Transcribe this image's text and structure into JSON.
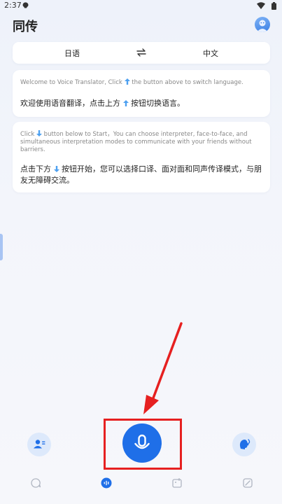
{
  "status_bar": {
    "time": "2:37",
    "app_icon": "qq-icon",
    "icons": [
      "wifi-icon",
      "battery-icon"
    ]
  },
  "header": {
    "title": "同传",
    "avatar_icon": "user-avatar"
  },
  "language_selector": {
    "source": "日语",
    "target": "中文",
    "swap_icon": "swap-arrows-icon"
  },
  "cards": [
    {
      "en_before": "Welcome to Voice Translator, Click",
      "en_after": "the button above to switch language.",
      "zh_before": "欢迎使用语音翻译，点击上方",
      "zh_after": "按钮切换语言。",
      "icon": "arrow-up-icon"
    },
    {
      "en_before": "Click",
      "en_after": "button below to Start，You can choose interpreter, face-to-face, and simultaneous interpretation modes to communicate with your friends without barriers.",
      "zh_before": "点击下方",
      "zh_after": "按钮开始，您可以选择口译、面对面和同声传译模式，与朋友无障碍交流。",
      "icon": "arrow-down-icon"
    }
  ],
  "bottom_controls": {
    "left_icon": "contacts-icon",
    "center_icon": "microphone-icon",
    "right_icon": "face-to-face-icon"
  },
  "nav": {
    "items": [
      "chat-icon",
      "voice-icon",
      "image-icon",
      "note-icon"
    ],
    "active_index": 1
  },
  "colors": {
    "accent": "#1f6fe8",
    "highlight": "#e62020",
    "background": "#f3f5fb",
    "arrow": "#4da0f0"
  }
}
